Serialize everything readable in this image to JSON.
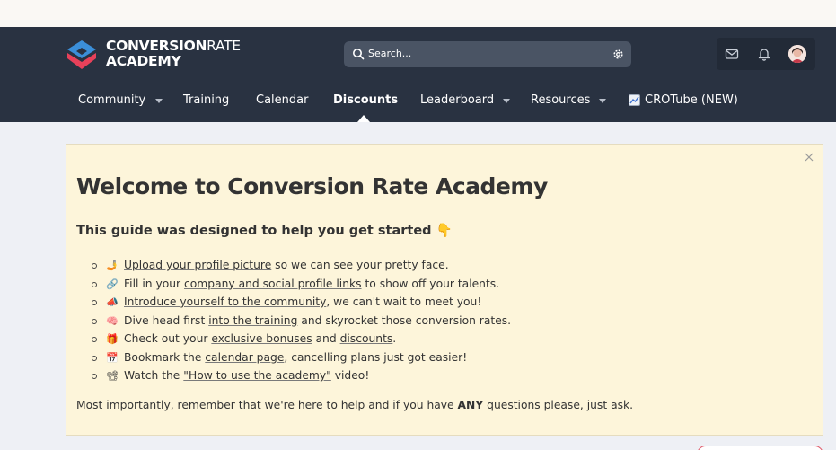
{
  "brand": {
    "logo_line1_bold": "CONVERSION",
    "logo_line1_light": "RATE",
    "logo_line2": "ACADEMY"
  },
  "header": {
    "search_placeholder": "Search...",
    "icons": [
      "envelope-icon",
      "bell-icon",
      "avatar"
    ]
  },
  "nav": {
    "items": [
      {
        "label": "Community",
        "dropdown": true
      },
      {
        "label": "Training",
        "dropdown": false
      },
      {
        "label": "Calendar",
        "dropdown": false
      },
      {
        "label": "Discounts",
        "dropdown": false,
        "active": true
      },
      {
        "label": "Leaderboard",
        "dropdown": true
      },
      {
        "label": "Resources",
        "dropdown": true
      },
      {
        "label": "CROTube (NEW)",
        "dropdown": false,
        "icon": "chart-icon"
      }
    ]
  },
  "notice": {
    "title": "Welcome to Conversion Rate Academy",
    "subtitle": "This guide was designed to help you get started",
    "subtitle_emoji": "👇",
    "items": [
      {
        "emoji": "🤳",
        "pre": "",
        "link1": "Upload your profile picture",
        "mid": " so we can see your pretty face.",
        "link2": "",
        "post": ""
      },
      {
        "emoji": "🔗",
        "pre": "Fill in your ",
        "link1": "company and social profile links",
        "mid": " to show off your talents.",
        "link2": "",
        "post": ""
      },
      {
        "emoji": "📣",
        "pre": "",
        "link1": "Introduce yourself to the community",
        "mid": ", we can't wait to meet you!",
        "link2": "",
        "post": ""
      },
      {
        "emoji": "🧠",
        "pre": "Dive head first ",
        "link1": "into the training",
        "mid": " and skyrocket those conversion rates.",
        "link2": "",
        "post": ""
      },
      {
        "emoji": "🎁",
        "pre": "Check out your ",
        "link1": "exclusive bonuses",
        "mid": " and ",
        "link2": "discounts",
        "post": "."
      },
      {
        "emoji": "📅",
        "pre": "Bookmark the ",
        "link1": "calendar page",
        "mid": ", cancelling plans just got easier!",
        "link2": "",
        "post": ""
      },
      {
        "emoji": "📽",
        "pre": "Watch the ",
        "link1": "\"How to use the academy\"",
        "mid": " video!",
        "link2": "",
        "post": ""
      }
    ],
    "closing_pre": "Most importantly, remember that we're here to help and if you have ",
    "closing_bold": "ANY",
    "closing_mid": " questions please, ",
    "closing_link": "just ask."
  },
  "colors": {
    "header_bg": "#293241",
    "notice_bg": "#fdf5da",
    "brand_red": "#e8415a",
    "brand_blue": "#3b8fd9"
  }
}
